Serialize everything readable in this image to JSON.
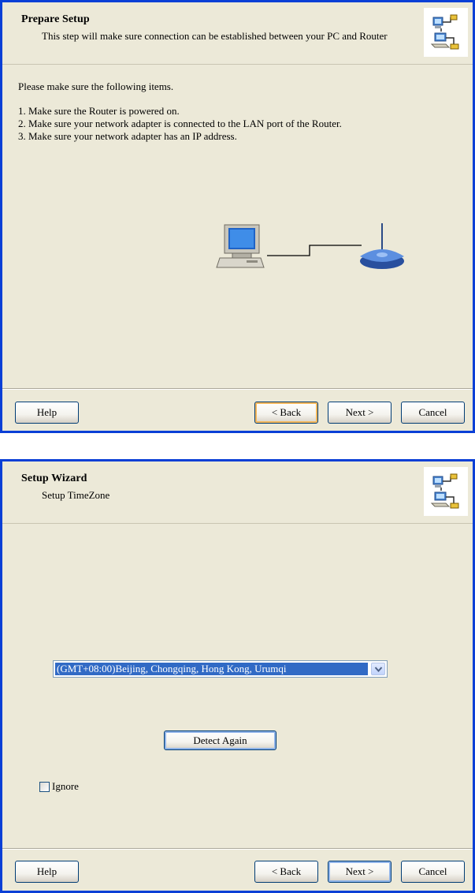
{
  "wizard1": {
    "header": {
      "title": "Prepare Setup",
      "subtitle": "This step will make sure connection can be established between your PC and Router"
    },
    "intro": "Please make sure the following items.",
    "items": [
      "1. Make sure the Router is powered on.",
      "2. Make sure your network adapter is connected to the LAN port of the Router.",
      "3. Make sure your network adapter has an IP address."
    ],
    "buttons": {
      "help": "Help",
      "back": "< Back",
      "next": "Next >",
      "cancel": "Cancel"
    }
  },
  "wizard2": {
    "header": {
      "title": "Setup Wizard",
      "subtitle": "Setup TimeZone"
    },
    "timezone": {
      "selected": "(GMT+08:00)Beijing, Chongqing, Hong Kong, Urumqi"
    },
    "detect_again": "Detect Again",
    "ignore": {
      "label": "Ignore",
      "checked": false
    },
    "buttons": {
      "help": "Help",
      "back": "< Back",
      "next": "Next >",
      "cancel": "Cancel"
    }
  },
  "icons": {
    "header_logo": "network-wizard-icon",
    "computer": "computer-icon",
    "router": "router-icon",
    "dropdown": "chevron-down-icon"
  },
  "colors": {
    "window_border": "#0a3fd6",
    "background": "#ece9d8",
    "selection": "#316ac5",
    "focus_orange": "#f5b75a"
  }
}
